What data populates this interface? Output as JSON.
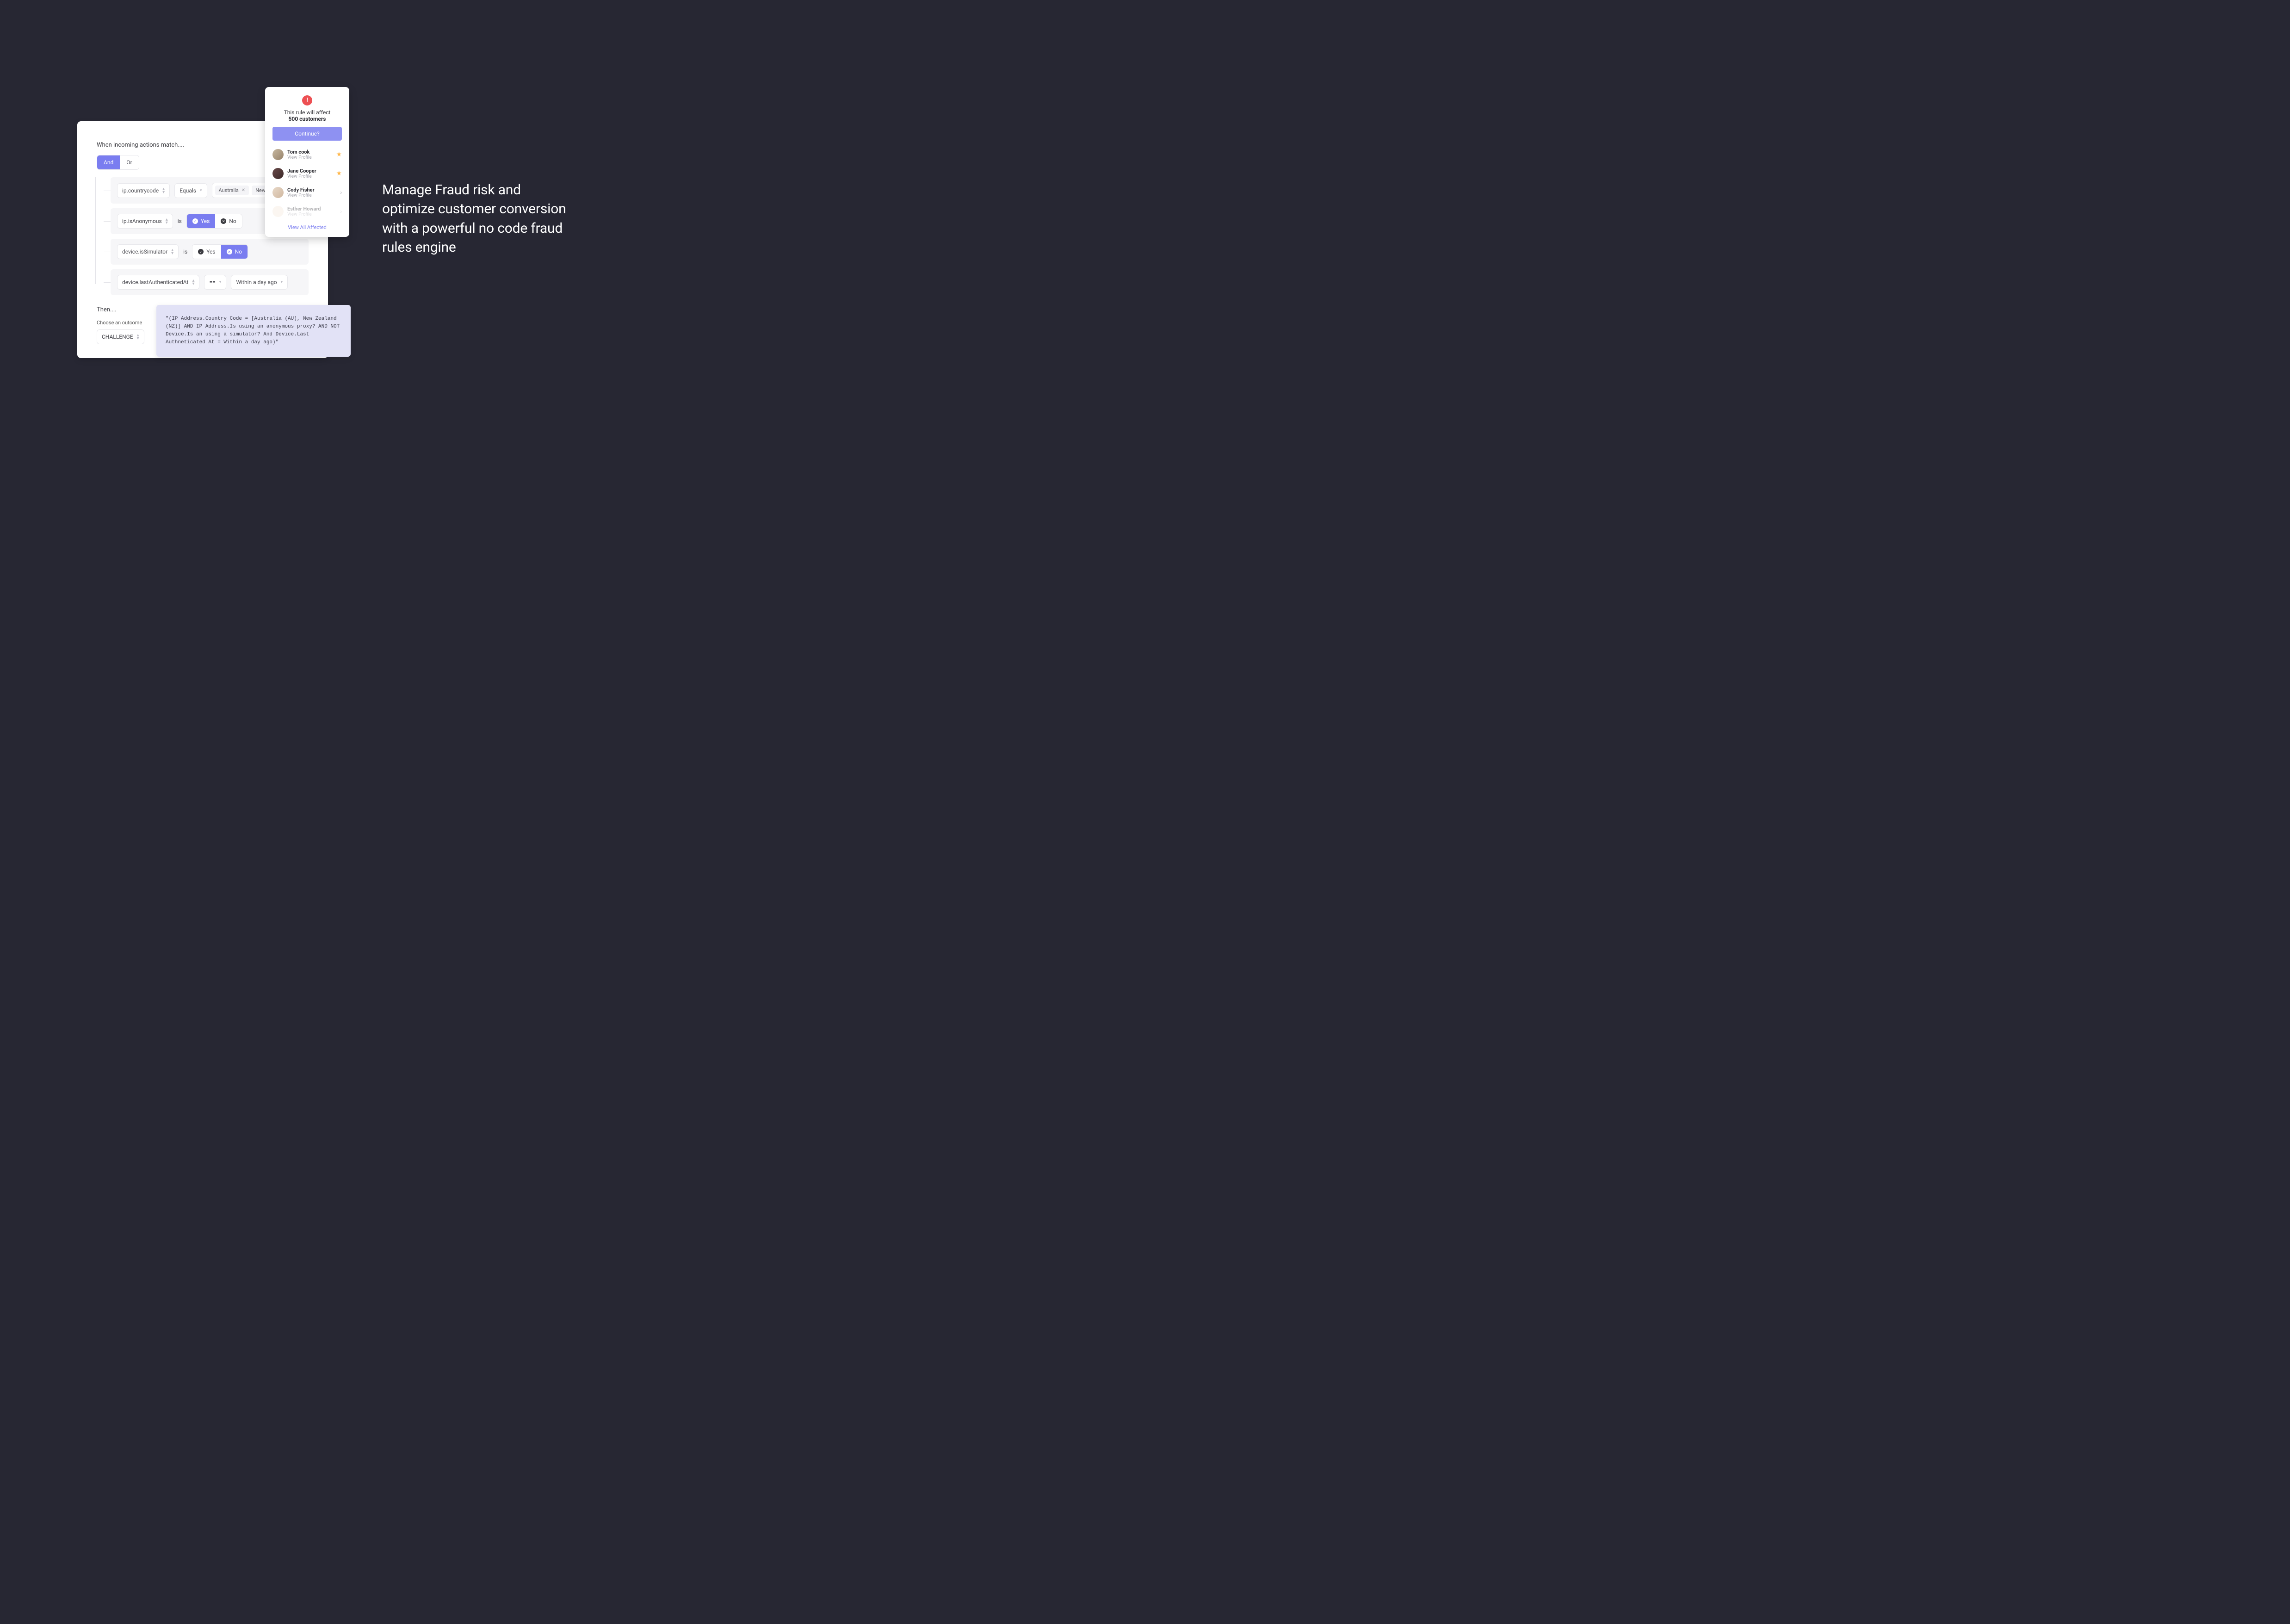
{
  "headline": "Manage Fraud risk and optimize customer conversion with a powerful no code fraud rules engine",
  "ruleBuilder": {
    "whenTitle": "When incoming actions match....",
    "logicAnd": "And",
    "logicOr": "Or",
    "conditions": [
      {
        "attr": "ip.countrycode",
        "op": "Equals",
        "tags": [
          "Australia",
          "New Zealand"
        ]
      },
      {
        "attr": "ip.isAnonymous",
        "link": "is",
        "yes": "Yes",
        "no": "No",
        "selected": "yes"
      },
      {
        "attr": "device.isSimulator",
        "link": "is",
        "yes": "Yes",
        "no": "No",
        "selected": "no"
      },
      {
        "attr": "device.lastAuthenticatedAt",
        "op": "==",
        "value": "Within a day ago"
      }
    ],
    "thenTitle": "Then....",
    "outcomeLabel": "Choose an outcome",
    "outcome": "CHALLENGE"
  },
  "codeBlock": "\"(IP Address.Country Code = [Australia (AU), New Zealand (NZ)] AND IP Address.Is using an anonymous proxy? AND NOT Device.Is an using a simulator? And Device.Last Authneticated At = Within a day ago)\"",
  "affect": {
    "title": "This rule will affect",
    "count": "500 customers",
    "button": "Continue?",
    "customers": [
      {
        "name": "Tom cook",
        "link": "View Profile",
        "starred": true
      },
      {
        "name": "Jane Cooper",
        "link": "View Profile",
        "starred": true
      },
      {
        "name": "Cody Fisher",
        "link": "View Profile",
        "starred": false
      },
      {
        "name": "Esther Howard",
        "link": "View Profile",
        "starred": false,
        "faded": true
      }
    ],
    "viewAll": "View All Affected"
  }
}
